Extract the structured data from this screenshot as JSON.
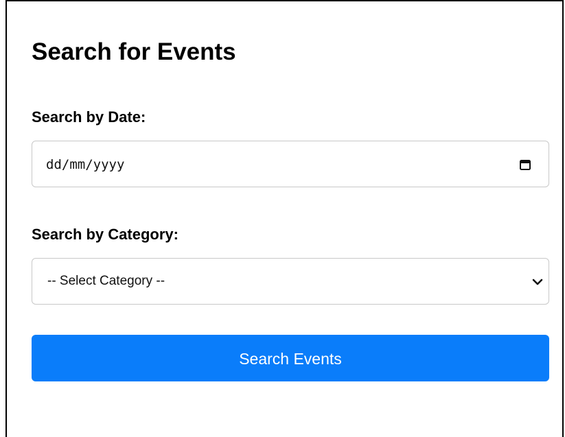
{
  "form": {
    "title": "Search for Events",
    "date_label": "Search by Date:",
    "date_placeholder": "dd/mm/yyyy",
    "category_label": "Search by Category:",
    "category_selected": "-- Select Category --",
    "submit_label": "Search Events"
  },
  "icons": {
    "date_picker": "calendar-icon",
    "select_arrow": "chevron-down-icon"
  },
  "colors": {
    "accent": "#0a7dfa",
    "text": "#000000",
    "border": "#c8c8c8"
  }
}
